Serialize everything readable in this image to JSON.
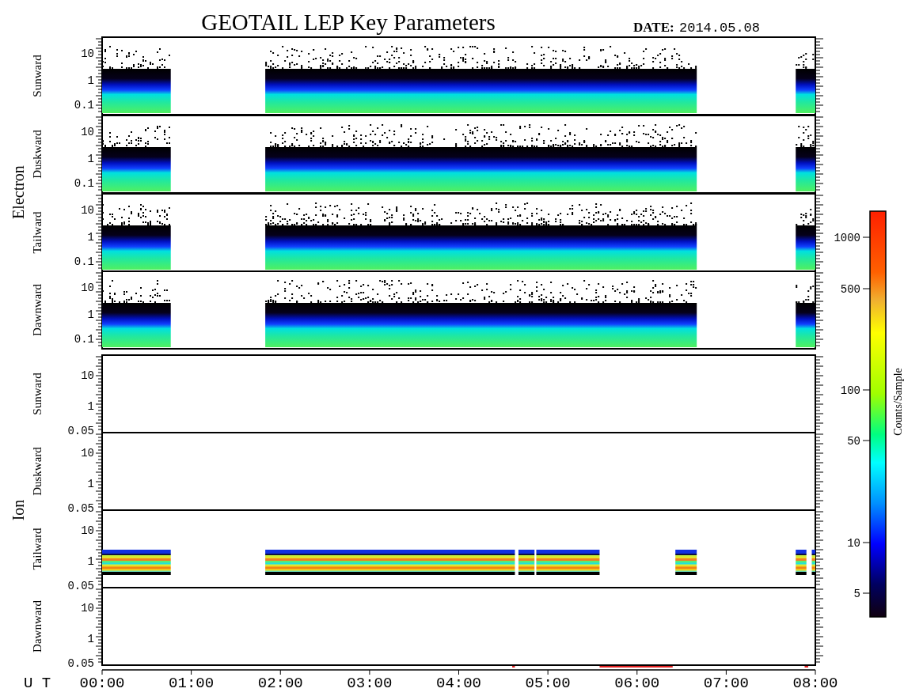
{
  "title": "GEOTAIL LEP Key Parameters",
  "date": {
    "label": "DATE:",
    "value": "2014.05.08"
  },
  "groups": [
    {
      "name": "Electron",
      "kind": "electron",
      "panels": [
        {
          "label": "Sunward",
          "has_data": true,
          "yticks": [
            "10",
            "1",
            "0.1"
          ]
        },
        {
          "label": "Duskward",
          "has_data": true,
          "yticks": [
            "10",
            "1",
            "0.1"
          ]
        },
        {
          "label": "Tailward",
          "has_data": true,
          "yticks": [
            "10",
            "1",
            "0.1"
          ]
        },
        {
          "label": "Dawnward",
          "has_data": true,
          "yticks": [
            "10",
            "1",
            "0.1"
          ]
        }
      ]
    },
    {
      "name": "Ion",
      "kind": "ion",
      "panels": [
        {
          "label": "Sunward",
          "has_data": false,
          "yticks": [
            "10",
            "1",
            "0.05"
          ]
        },
        {
          "label": "Duskward",
          "has_data": false,
          "yticks": [
            "10",
            "1",
            "0.05"
          ]
        },
        {
          "label": "Tailward",
          "has_data": true,
          "yticks": [
            "10",
            "1",
            "0.05"
          ]
        },
        {
          "label": "Dawnward",
          "has_data": false,
          "yticks": [
            "10",
            "1",
            "0.05"
          ]
        }
      ]
    }
  ],
  "x_axis": {
    "label": "U T",
    "ticks": [
      "00:00",
      "01:00",
      "02:00",
      "03:00",
      "04:00",
      "05:00",
      "06:00",
      "07:00",
      "08:00"
    ]
  },
  "colorbar": {
    "label": "Counts/Sample",
    "ticks": [
      "1000",
      "500",
      "100",
      "50",
      "10",
      "5"
    ]
  }
}
